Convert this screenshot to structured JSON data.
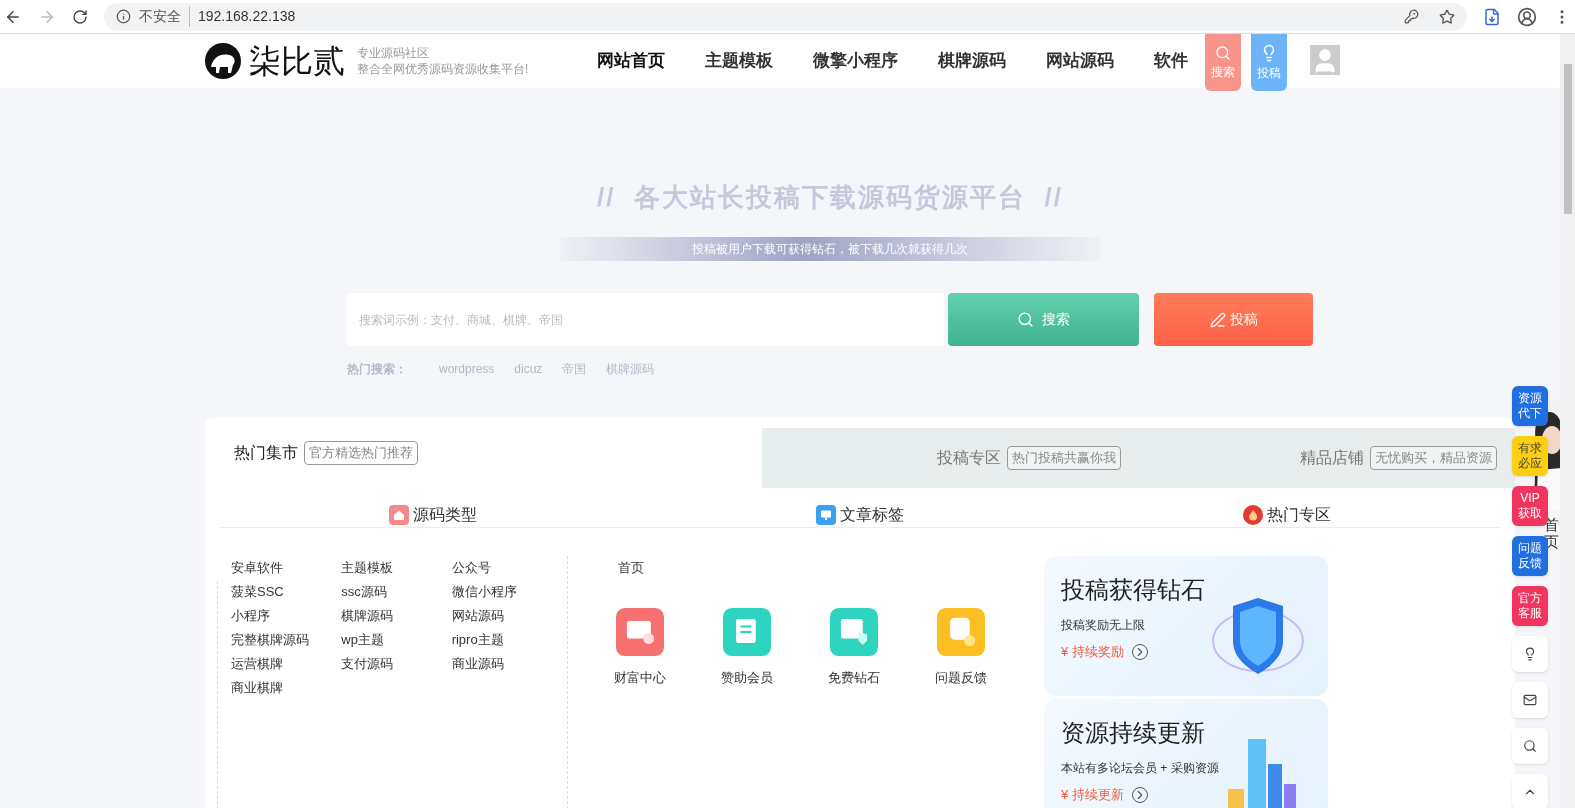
{
  "browser": {
    "security": "不安全",
    "url": "192.168.22.138"
  },
  "header": {
    "logo": "柒比贰",
    "slogan_1": "专业源码社区",
    "slogan_2": "整合全网优秀源码资源收集平台!",
    "nav": [
      {
        "label": "网站首页",
        "selected": true
      },
      {
        "label": "主题模板",
        "selected": false
      },
      {
        "label": "微擎小程序",
        "selected": false
      },
      {
        "label": "棋牌源码",
        "selected": false
      },
      {
        "label": "网站源码",
        "selected": false
      },
      {
        "label": "软件",
        "selected": false
      }
    ],
    "actions": [
      {
        "label": "搜索",
        "color": "#f8958a"
      },
      {
        "label": "投稿",
        "color": "#6cb4f7"
      }
    ]
  },
  "hero": {
    "title": "//  各大站长投稿下载源码货源平台  //",
    "subtitle": "投稿被用户下载可获得钻石，被下载几次就获得几次",
    "search_placeholder": "搜索词示例：支付、商城、棋牌、帝国",
    "search_button": "搜索",
    "submit_button": "投稿",
    "hot_label": "热门搜索：",
    "hot": [
      "wordpress",
      "dicuz",
      "帝国",
      "棋牌源码"
    ]
  },
  "tabs": [
    {
      "label": "热门集市",
      "tag": "官方精选热门推荐",
      "selected": true
    },
    {
      "label": "投稿专区",
      "tag": "热门投稿共赢你我",
      "selected": false
    },
    {
      "label": "精品店铺",
      "tag": "无忧购买，精品资源",
      "selected": false
    }
  ],
  "sections": [
    {
      "label": "源码类型",
      "kind": "type"
    },
    {
      "label": "文章标签",
      "kind": "tag"
    },
    {
      "label": "热门专区",
      "kind": "hot"
    }
  ],
  "categories": [
    [
      "安卓软件",
      "菠菜SSC",
      "小程序",
      "完整棋牌源码",
      "运营棋牌",
      "商业棋牌"
    ],
    [
      "主题模板",
      "ssc源码",
      "棋牌源码",
      "wp主题",
      "支付源码"
    ],
    [
      "公众号",
      "微信小程序",
      "网站源码",
      "ripro主题",
      "商业源码"
    ]
  ],
  "article_tags": [
    "首页"
  ],
  "services": [
    {
      "label": "财富中心",
      "color": "#f87171"
    },
    {
      "label": "赞助会员",
      "color": "#2dd4bf"
    },
    {
      "label": "免费钻石",
      "color": "#2dd4bf"
    },
    {
      "label": "问题反馈",
      "color": "#fbbf24"
    }
  ],
  "promos": [
    {
      "title": "投稿获得钻石",
      "text": "投稿奖励无上限",
      "link": "¥ 持续奖励"
    },
    {
      "title": "资源持续更新",
      "text": "本站有多论坛会员 + 采购资源",
      "link": "¥ 持续更新"
    }
  ],
  "side_buttons": [
    {
      "label": "资源代下",
      "color": "#1f6fe0"
    },
    {
      "label": "有求必应",
      "color": "#fcd010"
    },
    {
      "label": "VIP获取",
      "color": "#f0365f"
    },
    {
      "label": "问题反馈",
      "color": "#1f6fe0"
    },
    {
      "label": "官方客服",
      "color": "#f0365f"
    }
  ],
  "side_side_text": "首页"
}
